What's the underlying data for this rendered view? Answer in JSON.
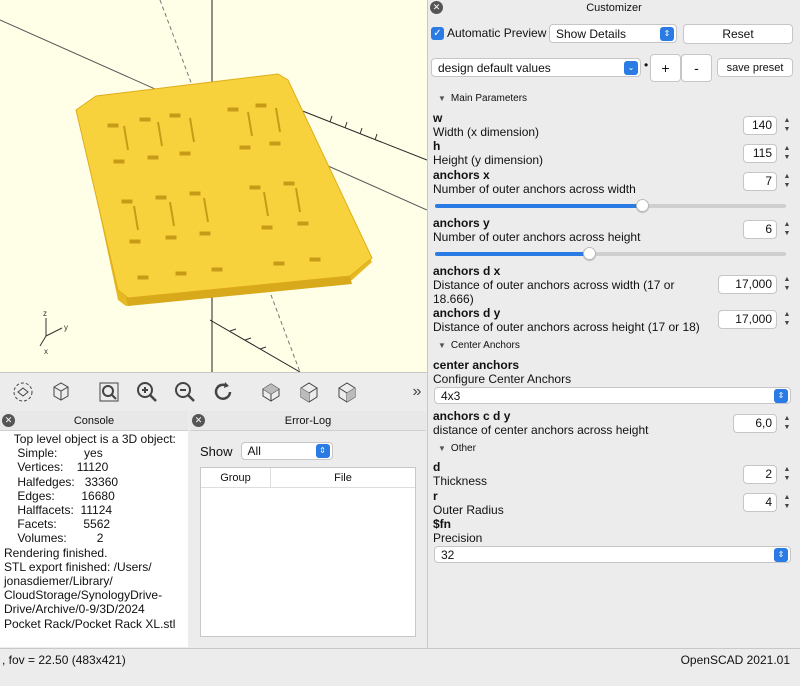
{
  "console": {
    "title": "Console",
    "lines": [
      "   Top level object is a 3D object:",
      "    Simple:        yes",
      "    Vertices:    11120",
      "    Halfedges:   33360",
      "    Edges:        16680",
      "    Halffacets:  11124",
      "    Facets:        5562",
      "    Volumes:         2",
      "Rendering finished.",
      "STL export finished: /Users/",
      "jonasdiemer/Library/",
      "CloudStorage/SynologyDrive-",
      "Drive/Archive/0-9/3D/2024",
      "Pocket Rack/Pocket Rack XL.stl"
    ]
  },
  "errorlog": {
    "title": "Error-Log",
    "show_label": "Show",
    "show_value": "All",
    "col_group": "Group",
    "col_file": "File"
  },
  "status": {
    "left": ", fov = 22.50 (483x421)",
    "right": "OpenSCAD 2021.01"
  },
  "customizer": {
    "title": "Customizer",
    "auto_preview_label": "Automatic Preview",
    "auto_preview_checked": true,
    "details_value": "Show Details",
    "reset_label": "Reset",
    "preset_value": "design default values",
    "preset_dot": "•",
    "add_label": "+",
    "remove_label": "-",
    "save_preset_label": "save preset",
    "sections": {
      "main": "Main Parameters",
      "center": "Center Anchors",
      "other": "Other"
    },
    "params": {
      "w": {
        "name": "w",
        "desc": "Width (x dimension)",
        "value": "140"
      },
      "h": {
        "name": "h",
        "desc": "Height (y dimension)",
        "value": "115"
      },
      "ax": {
        "name": "anchors x",
        "desc": "Number of outer anchors across width",
        "value": "7",
        "slider_fraction": 0.59
      },
      "ay": {
        "name": "anchors y",
        "desc": "Number of outer anchors across height",
        "value": "6",
        "slider_fraction": 0.44
      },
      "adx": {
        "name": "anchors d x",
        "desc1": "Distance of outer anchors across width (17 or",
        "desc2": "18.666)",
        "value": "17,000"
      },
      "ady": {
        "name": "anchors d y",
        "desc": "Distance of outer anchors across height (17 or 18)",
        "value": "17,000"
      },
      "ca": {
        "name": "center anchors",
        "desc": "Configure Center Anchors",
        "value": "4x3"
      },
      "cady": {
        "name": "anchors c d y",
        "desc": "distance of center anchors across height",
        "value": "6,0"
      },
      "d": {
        "name": "d",
        "desc": "Thickness",
        "value": "2"
      },
      "r": {
        "name": "r",
        "desc": "Outer Radius",
        "value": "4"
      },
      "fn": {
        "name": "$fn",
        "desc": "Precision",
        "value": "32"
      }
    }
  },
  "colors": {
    "accent": "#2a7be4",
    "model": "#f8d23c",
    "viewport_bg": "#ffffe8"
  },
  "icons": [
    "view-all-icon",
    "reset-view-icon",
    "zoom-all-icon",
    "zoom-in-icon",
    "zoom-out-icon",
    "rotate-reset-icon",
    "view-top-icon",
    "view-front-icon",
    "view-diagonal-icon",
    "more-icon"
  ]
}
